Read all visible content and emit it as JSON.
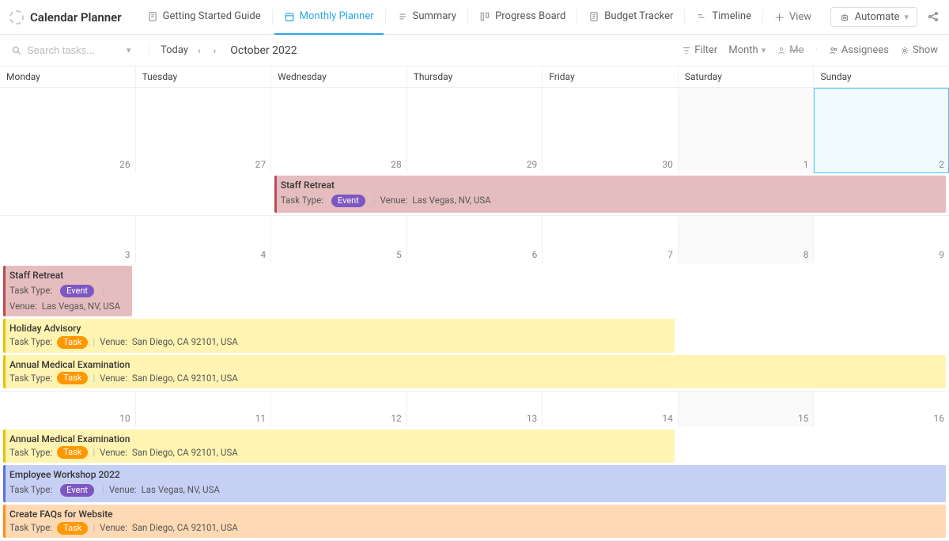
{
  "header": {
    "title": "Calendar Planner",
    "tabs": [
      {
        "label": "Getting Started Guide"
      },
      {
        "label": "Monthly Planner"
      },
      {
        "label": "Summary"
      },
      {
        "label": "Progress Board"
      },
      {
        "label": "Budget Tracker"
      },
      {
        "label": "Timeline"
      }
    ],
    "add_view_label": "View",
    "automate_label": "Automate"
  },
  "toolbar": {
    "search_placeholder": "Search tasks...",
    "today_label": "Today",
    "month_label": "October 2022",
    "filter_label": "Filter",
    "month_dd_label": "Month",
    "me_label": "Me",
    "assignees_label": "Assignees",
    "show_label": "Show"
  },
  "days": [
    "Monday",
    "Tuesday",
    "Wednesday",
    "Thursday",
    "Friday",
    "Saturday",
    "Sunday"
  ],
  "week1_dates": [
    "26",
    "27",
    "28",
    "29",
    "30",
    "1",
    "2"
  ],
  "week2_dates": [
    "3",
    "4",
    "5",
    "6",
    "7",
    "8",
    "9"
  ],
  "week3_dates": [
    "10",
    "11",
    "12",
    "13",
    "14",
    "15",
    "16"
  ],
  "labels": {
    "task_type": "Task Type:",
    "venue": "Venue:",
    "pill_event": "Event",
    "pill_task": "Task"
  },
  "events": {
    "w1_e1": {
      "title": "Staff Retreat",
      "venue": "Las Vegas, NV, USA"
    },
    "w2_e1": {
      "title": "Staff Retreat",
      "venue": "Las Vegas, NV, USA"
    },
    "w2_e2": {
      "title": "Holiday Advisory",
      "venue": "San Diego, CA 92101, USA"
    },
    "w2_e3": {
      "title": "Annual Medical Examination",
      "venue": "San Diego, CA 92101, USA"
    },
    "w3_e1": {
      "title": "Annual Medical Examination",
      "venue": "San Diego, CA 92101, USA"
    },
    "w3_e2": {
      "title": "Employee Workshop 2022",
      "venue": "Las Vegas, NV, USA"
    },
    "w3_e3": {
      "title": "Create FAQs for Website",
      "venue": "San Diego, CA 92101, USA"
    }
  }
}
